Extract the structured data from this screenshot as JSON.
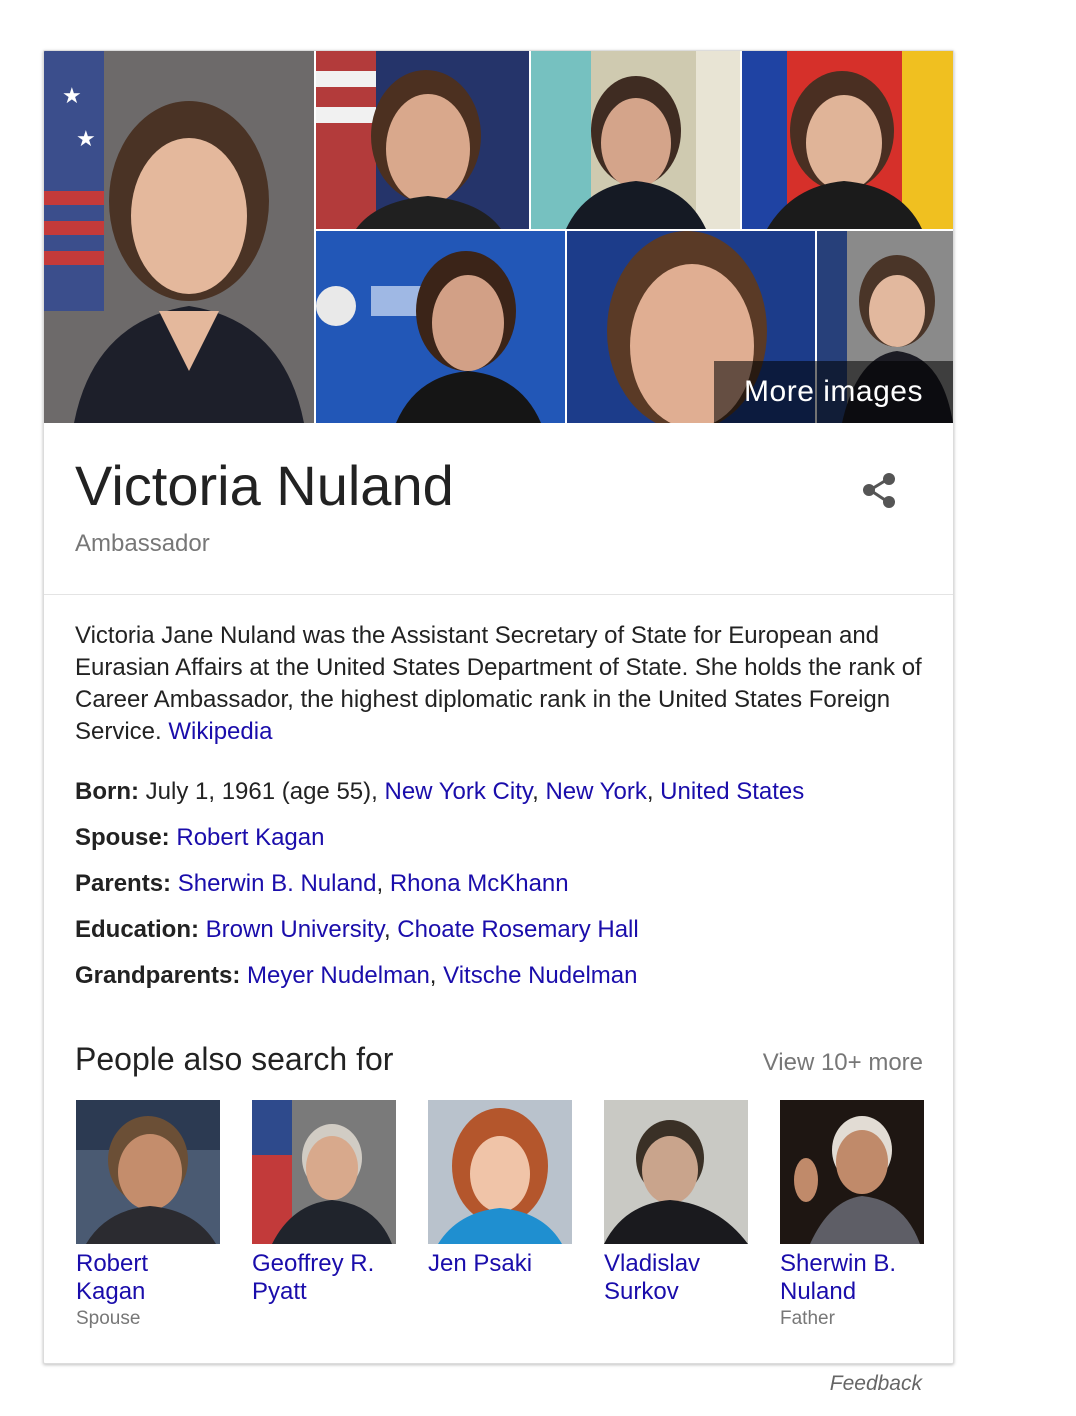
{
  "mosaic": {
    "more_images_label": "More images"
  },
  "entity": {
    "title": "Victoria Nuland",
    "subtitle": "Ambassador",
    "share_icon": "share-icon"
  },
  "description": {
    "text": "Victoria Jane Nuland was the Assistant Secretary of State for European and Eurasian Affairs at the United States Department of State. She holds the rank of Career Ambassador, the highest diplomatic rank in the United States Foreign Service.",
    "source_link": "Wikipedia"
  },
  "facts": [
    {
      "label": "Born:",
      "plain": "July 1, 1961 (age 55),",
      "links": [
        "New York City",
        "New York",
        "United States"
      ]
    },
    {
      "label": "Spouse:",
      "plain": "",
      "links": [
        "Robert Kagan"
      ]
    },
    {
      "label": "Parents:",
      "plain": "",
      "links": [
        "Sherwin B. Nuland",
        "Rhona McKhann"
      ]
    },
    {
      "label": "Education:",
      "plain": "",
      "links": [
        "Brown University",
        "Choate Rosemary Hall"
      ]
    },
    {
      "label": "Grandparents:",
      "plain": "",
      "links": [
        "Meyer Nudelman",
        "Vitsche Nudelman"
      ]
    }
  ],
  "people_also_search": {
    "title": "People also search for",
    "view_more": "View 10+ more",
    "people": [
      {
        "name": "Robert Kagan",
        "relation": "Spouse"
      },
      {
        "name": "Geoffrey R. Pyatt",
        "relation": ""
      },
      {
        "name": "Jen Psaki",
        "relation": ""
      },
      {
        "name": "Vladislav Surkov",
        "relation": ""
      },
      {
        "name": "Sherwin B. Nuland",
        "relation": "Father"
      }
    ]
  },
  "footer": {
    "feedback": "Feedback"
  },
  "colors": {
    "link": "#1a0dab",
    "muted": "#777777",
    "text": "#222222"
  }
}
